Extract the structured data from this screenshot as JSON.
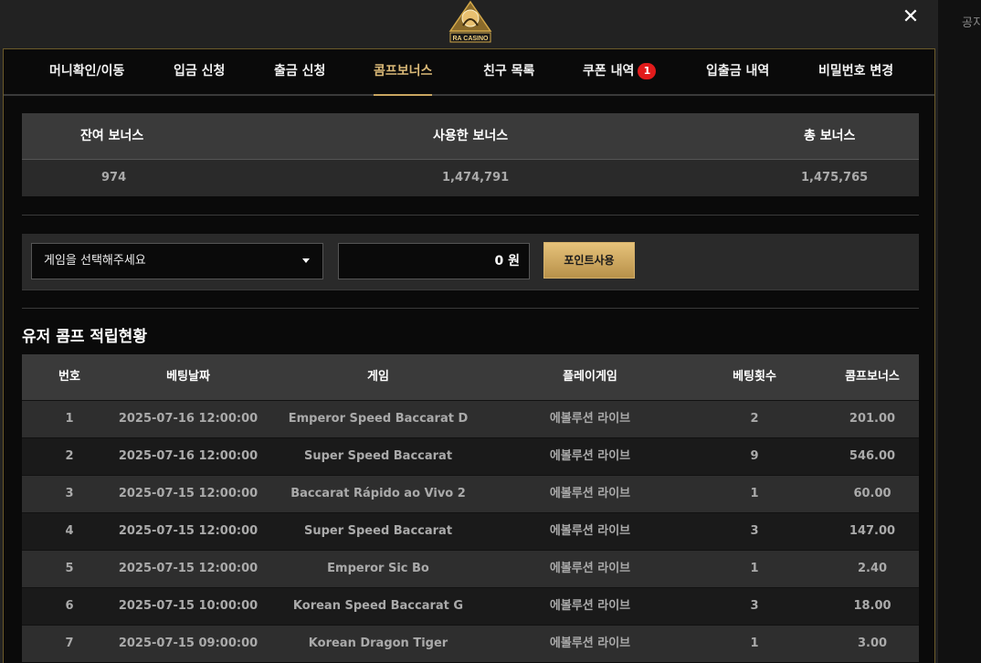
{
  "window": {
    "close_label": "✕",
    "logo_text": "RA CASINO",
    "peek_text": "공지"
  },
  "tabs": [
    {
      "label": "머니확인/이동"
    },
    {
      "label": "입금 신청"
    },
    {
      "label": "출금 신청"
    },
    {
      "label": "콤프보너스",
      "active": true
    },
    {
      "label": "친구 목록"
    },
    {
      "label": "쿠폰 내역",
      "badge": "1"
    },
    {
      "label": "입출금 내역"
    },
    {
      "label": "비밀번호 변경"
    }
  ],
  "summary": {
    "headers": [
      "잔여 보너스",
      "사용한 보너스",
      "총 보너스"
    ],
    "values": [
      "974",
      "1,474,791",
      "1,475,765"
    ]
  },
  "use": {
    "select_label": "게임을 선택해주세요",
    "amount": "0 원",
    "button_label": "포인트사용"
  },
  "history": {
    "title": "유저 콤프 적립현황",
    "columns": [
      "번호",
      "베팅날짜",
      "게임",
      "플레이게임",
      "베팅횟수",
      "콤프보너스"
    ],
    "rows": [
      [
        "1",
        "2025-07-16 12:00:00",
        "Emperor Speed Baccarat D",
        "에볼루션 라이브",
        "2",
        "201.00"
      ],
      [
        "2",
        "2025-07-16 12:00:00",
        "Super Speed Baccarat",
        "에볼루션 라이브",
        "9",
        "546.00"
      ],
      [
        "3",
        "2025-07-15 12:00:00",
        "Baccarat Rápido ao Vivo 2",
        "에볼루션 라이브",
        "1",
        "60.00"
      ],
      [
        "4",
        "2025-07-15 12:00:00",
        "Super Speed Baccarat",
        "에볼루션 라이브",
        "3",
        "147.00"
      ],
      [
        "5",
        "2025-07-15 12:00:00",
        "Emperor Sic Bo",
        "에볼루션 라이브",
        "1",
        "2.40"
      ],
      [
        "6",
        "2025-07-15 10:00:00",
        "Korean Speed Baccarat G",
        "에볼루션 라이브",
        "3",
        "18.00"
      ],
      [
        "7",
        "2025-07-15 09:00:00",
        "Korean Dragon Tiger",
        "에볼루션 라이브",
        "1",
        "3.00"
      ]
    ]
  },
  "colors": {
    "accent": "#c9a660",
    "badge": "#e21b1b",
    "header_bg": "#3a3a3a"
  }
}
